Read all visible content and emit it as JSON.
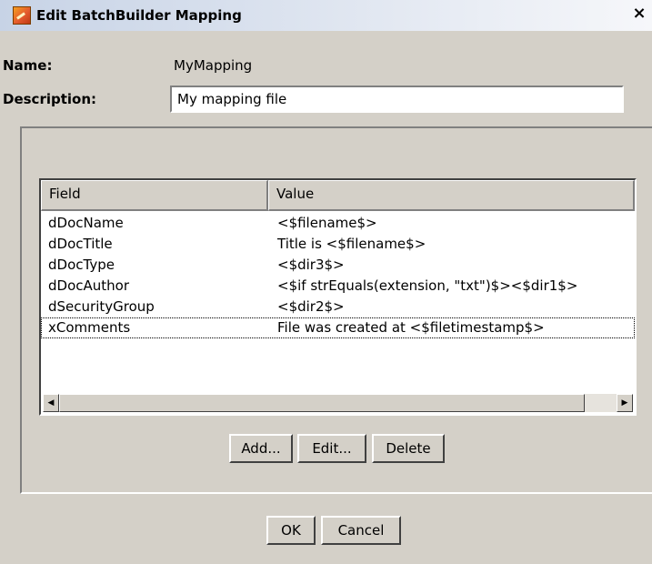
{
  "window": {
    "title": "Edit BatchBuilder Mapping",
    "close_glyph": "×"
  },
  "form": {
    "name_label": "Name:",
    "name_value": "MyMapping",
    "description_label": "Description:",
    "description_value": "My mapping file"
  },
  "table": {
    "columns": [
      "Field",
      "Value"
    ],
    "rows": [
      {
        "field": "dDocName",
        "value": "<$filename$>"
      },
      {
        "field": "dDocTitle",
        "value": "Title is <$filename$>"
      },
      {
        "field": "dDocType",
        "value": "<$dir3$>"
      },
      {
        "field": "dDocAuthor",
        "value": "<$if strEquals(extension, \"txt\")$><$dir1$>"
      },
      {
        "field": "dSecurityGroup",
        "value": "<$dir2$>"
      },
      {
        "field": "xComments",
        "value": "File was created at <$filetimestamp$>"
      }
    ],
    "selected_row": 5,
    "scroll_left_glyph": "◀",
    "scroll_right_glyph": "▶"
  },
  "buttons": {
    "add": "Add...",
    "edit": "Edit...",
    "delete": "Delete",
    "ok": "OK",
    "cancel": "Cancel"
  },
  "icons": {
    "app": "batchbuilder-icon",
    "close": "close-icon"
  }
}
